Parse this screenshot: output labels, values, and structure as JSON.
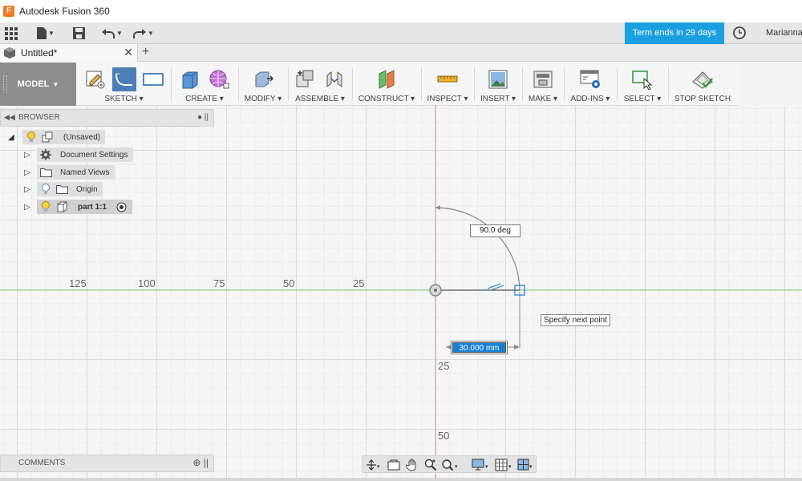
{
  "app": {
    "title": "Autodesk Fusion 360",
    "icon_letter": "F",
    "accent": "#1a9fe0"
  },
  "quick_access": {
    "term_banner": "Term ends in 29 days",
    "user_name": "Marianna R"
  },
  "document": {
    "tab_name": "Untitled*",
    "close_glyph": "✕",
    "new_tab_glyph": "+"
  },
  "toolbar": {
    "workspace": "MODEL",
    "groups": {
      "sketch": "SKETCH",
      "create": "CREATE",
      "modify": "MODIFY",
      "assemble": "ASSEMBLE",
      "construct": "CONSTRUCT",
      "inspect": "INSPECT",
      "insert": "INSERT",
      "make": "MAKE",
      "addins": "ADD-INS",
      "select": "SELECT",
      "stop_sketch": "STOP SKETCH"
    }
  },
  "browser": {
    "title": "BROWSER",
    "items": [
      {
        "label": "(Unsaved)"
      },
      {
        "label": "Document Settings"
      },
      {
        "label": "Named Views"
      },
      {
        "label": "Origin"
      },
      {
        "label": "part 1:1"
      }
    ]
  },
  "comments": {
    "title": "COMMENTS"
  },
  "canvas": {
    "axis_labels": {
      "x125": "125",
      "x100": "100",
      "x75": "75",
      "x50": "50",
      "x25": "25",
      "y25": "25",
      "y50": "50"
    },
    "angle_value": "90.0 deg",
    "length_value": "30.000 mm",
    "tooltip": "Specify next point",
    "colors": {
      "x_axis": "#7ccf7c",
      "y_axis": "#e88a8a",
      "sketch_line": "#555555",
      "selection": "#1a7fd4"
    }
  }
}
